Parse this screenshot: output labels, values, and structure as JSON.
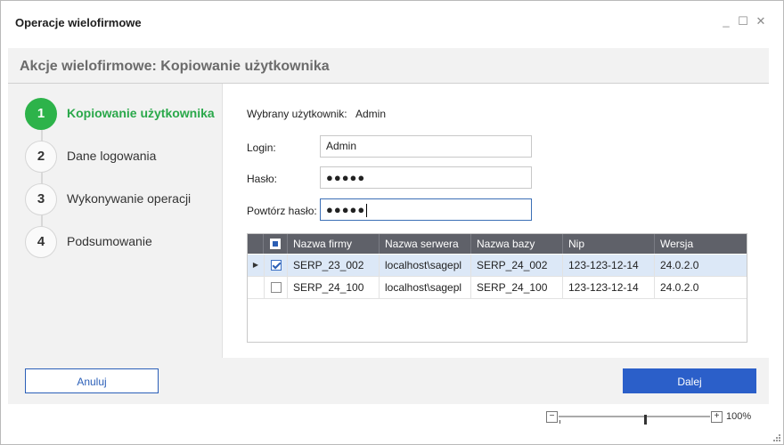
{
  "window": {
    "title": "Operacje wielofirmowe",
    "minimize_glyph": "_",
    "maximize_glyph": "☐",
    "close_glyph": "✕"
  },
  "panel": {
    "title": "Akcje wielofirmowe: Kopiowanie użytkownika"
  },
  "steps": [
    {
      "number": "1",
      "label": "Kopiowanie użytkownika",
      "active": true
    },
    {
      "number": "2",
      "label": "Dane logowania",
      "active": false
    },
    {
      "number": "3",
      "label": "Wykonywanie operacji",
      "active": false
    },
    {
      "number": "4",
      "label": "Podsumowanie",
      "active": false
    }
  ],
  "form": {
    "selected_user_label": "Wybrany użytkownik:",
    "selected_user_value": "Admin",
    "login_label": "Login:",
    "login_value": "Admin",
    "password_label": "Hasło:",
    "password_value": "●●●●●",
    "repeat_password_label": "Powtórz hasło:",
    "repeat_password_value": "●●●●●"
  },
  "grid": {
    "columns": [
      "Nazwa firmy",
      "Nazwa serwera",
      "Nazwa bazy",
      "Nip",
      "Wersja"
    ],
    "rows": [
      {
        "checked": true,
        "selected": true,
        "current_row_indicator": "▶",
        "cells": [
          "SERP_23_002",
          "localhost\\sagepl",
          "SERP_24_002",
          "123-123-12-14",
          "24.0.2.0"
        ]
      },
      {
        "checked": false,
        "selected": false,
        "current_row_indicator": "",
        "cells": [
          "SERP_24_100",
          "localhost\\sagepl",
          "SERP_24_100",
          "123-123-12-14",
          "24.0.2.0"
        ]
      }
    ]
  },
  "buttons": {
    "cancel": "Anuluj",
    "next": "Dalej"
  },
  "zoom": {
    "minus": "−",
    "plus": "+",
    "label": "100%"
  },
  "colors": {
    "accent_green": "#2db34a",
    "accent_blue": "#2b5fc9",
    "grid_header": "#5f6169",
    "selected_row": "#dce8f7"
  }
}
